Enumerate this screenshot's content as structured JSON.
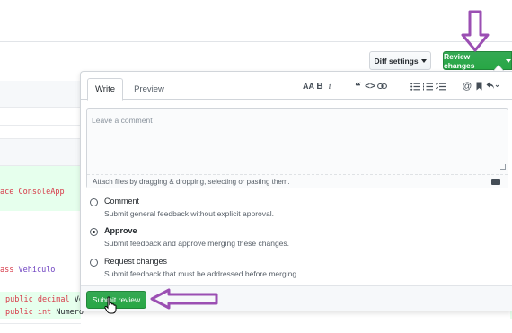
{
  "header": {
    "diff_settings_label": "Diff settings",
    "review_changes_label": "Review changes"
  },
  "code_lines": {
    "namespace": "ace ConsoleApp",
    "class_kw": "ass",
    "class_name": "Vehiculo",
    "line1_kw": "public decimal",
    "line1_rest": "Ve",
    "line2_kw": "public int",
    "line2_rest": "Numero"
  },
  "review_panel": {
    "tabs": [
      "Write",
      "Preview"
    ],
    "active_tab": "Write",
    "toolbar_icons": [
      "text-size-icon",
      "bold-icon",
      "italic-icon",
      "quote-icon",
      "code-icon",
      "link-icon",
      "unordered-list-icon",
      "ordered-list-icon",
      "task-list-icon",
      "mention-icon",
      "bookmark-icon",
      "reply-icon"
    ],
    "comment": {
      "placeholder": "Leave a comment",
      "value": "",
      "attach_text": "Attach files by dragging & dropping, selecting or pasting them."
    },
    "options": [
      {
        "title": "Comment",
        "description": "Submit general feedback without explicit approval.",
        "checked": false
      },
      {
        "title": "Approve",
        "description": "Submit feedback and approve merging these changes.",
        "checked": true
      },
      {
        "title": "Request changes",
        "description": "Submit feedback that must be addressed before merging.",
        "checked": false
      }
    ],
    "submit_label": "Submit review"
  },
  "colors": {
    "primary_green": "#28a745",
    "annotation_arrow": "#9b4fb3"
  }
}
